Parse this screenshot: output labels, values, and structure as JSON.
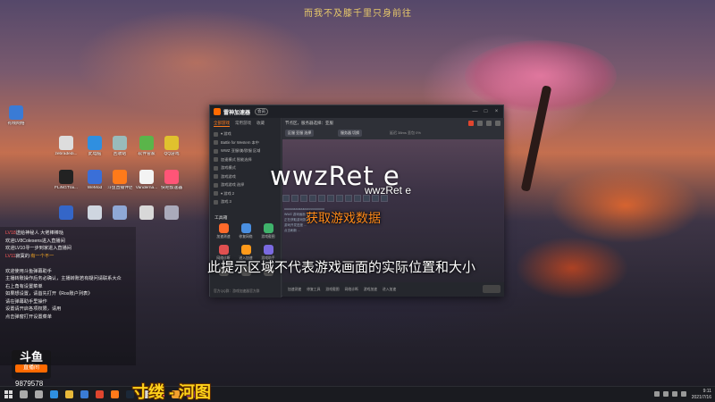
{
  "desktop": {
    "top_caption": "而我不及膝千里只身前往",
    "icons": [
      {
        "label": "有线网络",
        "color": "#3a7bd5"
      },
      {
        "label": "zebradedi...",
        "color": "#ddd"
      },
      {
        "label": "此电脑",
        "color": "#2f8fe0"
      },
      {
        "label": "回收站",
        "color": "#9bb"
      },
      {
        "label": "软件管家",
        "color": "#5ab54a"
      },
      {
        "label": "QQ游戏",
        "color": "#e0c12e"
      },
      {
        "label": "FLiNGTrai...",
        "color": "#222"
      },
      {
        "label": "WeMod",
        "color": "#3a6fd8"
      },
      {
        "label": "斗鱼直播伴侣",
        "color": "#ff7a1a"
      },
      {
        "label": "Vanderna...",
        "color": "#f3f3f3"
      },
      {
        "label": "快吧加速器",
        "color": "#ff5577"
      },
      {
        "label": "",
        "color": "#3466c8"
      },
      {
        "label": "",
        "color": "#cfd6e0"
      },
      {
        "label": "",
        "color": "#8fa8d6"
      },
      {
        "label": "",
        "color": "#d8d8d8"
      },
      {
        "label": "",
        "color": "#aab"
      }
    ]
  },
  "chat": {
    "lines": [
      {
        "level": "LV18",
        "text": "送给神秘人 大佬棒棒哒",
        "tag": ""
      },
      {
        "level": "",
        "text": "欢迎LV8Colesens进入直播间",
        "tag": ""
      },
      {
        "level": "",
        "text": "欢迎LV10寻一步到家进入直播间",
        "tag": ""
      },
      {
        "level": "LV11",
        "text": "寂寞的:",
        "tag": "有一个不一"
      },
      {
        "level": "",
        "text": "",
        "tag": ""
      },
      {
        "level": "",
        "text": "欢迎使用斗鱼弹幕助手",
        "tag": ""
      },
      {
        "level": "",
        "text": "主播转账操作后务必确认，主播转账若有疑问请联系大众",
        "tag": ""
      },
      {
        "level": "",
        "text": "右上角有设置菜单",
        "tag": ""
      },
      {
        "level": "",
        "text": "如果想设置，请首先打开《Ros账户列表》",
        "tag": ""
      },
      {
        "level": "",
        "text": "请在弹幕助手里操作",
        "tag": ""
      },
      {
        "level": "",
        "text": "设置请开启各项权限，请用",
        "tag": ""
      },
      {
        "level": "",
        "text": "点击弹窗打开设置菜单",
        "tag": ""
      }
    ],
    "logo_big": "斗鱼",
    "logo_small": "直播间",
    "room_id": "9879578"
  },
  "app": {
    "name": "雷神加速器",
    "vip": "会员",
    "window_controls": [
      "—",
      "□",
      "×"
    ],
    "sidebar_tabs": [
      {
        "label": "全部游戏",
        "active": true
      },
      {
        "label": "常用游戏",
        "active": false
      },
      {
        "label": "收藏",
        "active": false
      }
    ],
    "games": [
      "▾ 游戏",
      "Battle for Western 本中",
      "WWZ 亚服/美/欧服 区域",
      "加速模式 智能选择",
      "游戏模式",
      "游戏游戏",
      "游戏游戏 选择",
      "▾ 游戏 2",
      "游戏 3"
    ],
    "toolbox_label": "工具箱",
    "tools": [
      "加速测速",
      "修复网络",
      "游戏截图",
      "网络诊断",
      "进入加速",
      "游戏助手",
      "",
      "",
      ""
    ],
    "footer": "官方QQ群：游戏加速器官方群",
    "main": {
      "region": "节点区，服务器选择：亚服",
      "pills": [
        "区服 亚服 选择",
        "服务器 切换"
      ],
      "meta": "延迟 38ms  丢包 0%",
      "mini_text": [
        "uuuuuuuuuuuuuuuuuuuuuuu",
        "WWZ 游戏画面 (预览)",
        "正在获取游戏数据 ....",
        "游戏开发进度 ...",
        "点击刷新 ..."
      ],
      "bottom_tools": [
        "加速测速",
        "修复工具",
        "游戏截图",
        "网络诊断",
        "游戏加速",
        "进入加速"
      ]
    }
  },
  "overlay": {
    "watermark": "wwzRet  e",
    "watermark_small": "wwzRet  e",
    "fetching": "获取游戏数据",
    "hint": "此提示区域不代表游戏画面的实际位置和大小"
  },
  "streamer": {
    "name": "寸缕 - 河图"
  },
  "taskbar": {
    "icons": [
      {
        "name": "search-icon",
        "color": "#aaa"
      },
      {
        "name": "task-view-icon",
        "color": "#aaa"
      },
      {
        "name": "edge-icon",
        "color": "#2f8fe0"
      },
      {
        "name": "explorer-icon",
        "color": "#e8b93a"
      },
      {
        "name": "store-icon",
        "color": "#3a7bd5"
      },
      {
        "name": "chrome-icon",
        "color": "#e0452e"
      },
      {
        "name": "douyu-icon",
        "color": "#ff7a1a"
      },
      {
        "name": "steam-icon",
        "color": "#1b2838"
      },
      {
        "name": "wegame-icon",
        "color": "#d8d8d8"
      },
      {
        "name": "game-icon",
        "color": "#ff5a5a"
      },
      {
        "name": "app-icon",
        "color": "#f3a12e"
      },
      {
        "name": "app-icon-2",
        "color": "#a040c0"
      },
      {
        "name": "app-icon-3",
        "color": "#888"
      }
    ],
    "time": "9:11",
    "date": "2021/7/16"
  }
}
